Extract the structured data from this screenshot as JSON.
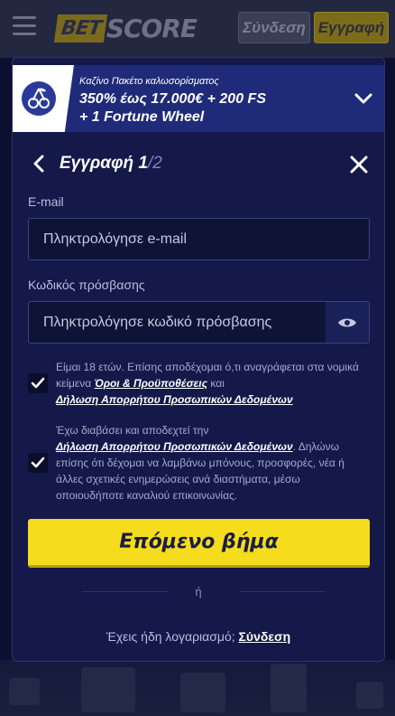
{
  "header": {
    "logo_bet": "BET",
    "logo_score": "SCORE",
    "login_label": "Σύνδεση",
    "register_label": "Εγγραφή"
  },
  "promo": {
    "small": "Καζίνο Πακέτο καλωσορίσματος",
    "line1": "350% έως 17.000€ + 200 FS",
    "line2": "+ 1 Fortune Wheel"
  },
  "modal": {
    "title_prefix": "Εγγραφή ",
    "title_step": "1",
    "title_total": "/2"
  },
  "form": {
    "email_label": "E-mail",
    "email_placeholder": "Πληκτρολόγησε e-mail",
    "password_label": "Κωδικός πρόσβασης",
    "password_placeholder": "Πληκτρολόγησε κωδικό πρόσβασης"
  },
  "consent1": {
    "text1": "Είμαι 18 ετών. Επίσης αποδέχομαι ό,τι αναγράφεται στα νομικά κείμενα ",
    "link1": "Όροι & Προϋποθέσεις",
    "text2": " και ",
    "link2": "Δήλωση Απορρήτου Προσωπικών Δεδομένων",
    "checked": true
  },
  "consent2": {
    "text1": "Έχω διαβάσει και αποδεχτεί την ",
    "link1": "Δήλωση Απορρήτου Προσωπικών Δεδομένων",
    "text2": ". Δηλώνω επίσης ότι δέχομαι να λαμβάνω μπόνους, προσφορές, νέα ή άλλες σχετικές ενημερώσεις ανά διαστήματα, μέσω οποιουδήποτε καναλιού επικοινωνίας.",
    "checked": true
  },
  "actions": {
    "next_label": "Επόμενο βήμα",
    "or_label": "ή",
    "have_account": "Έχεις ήδη λογαριασμό; ",
    "login_link": "Σύνδεση"
  },
  "colors": {
    "accent_yellow": "#f5dc1c",
    "modal_bg": "#14194a",
    "promo_bg": "#1f2b78"
  }
}
